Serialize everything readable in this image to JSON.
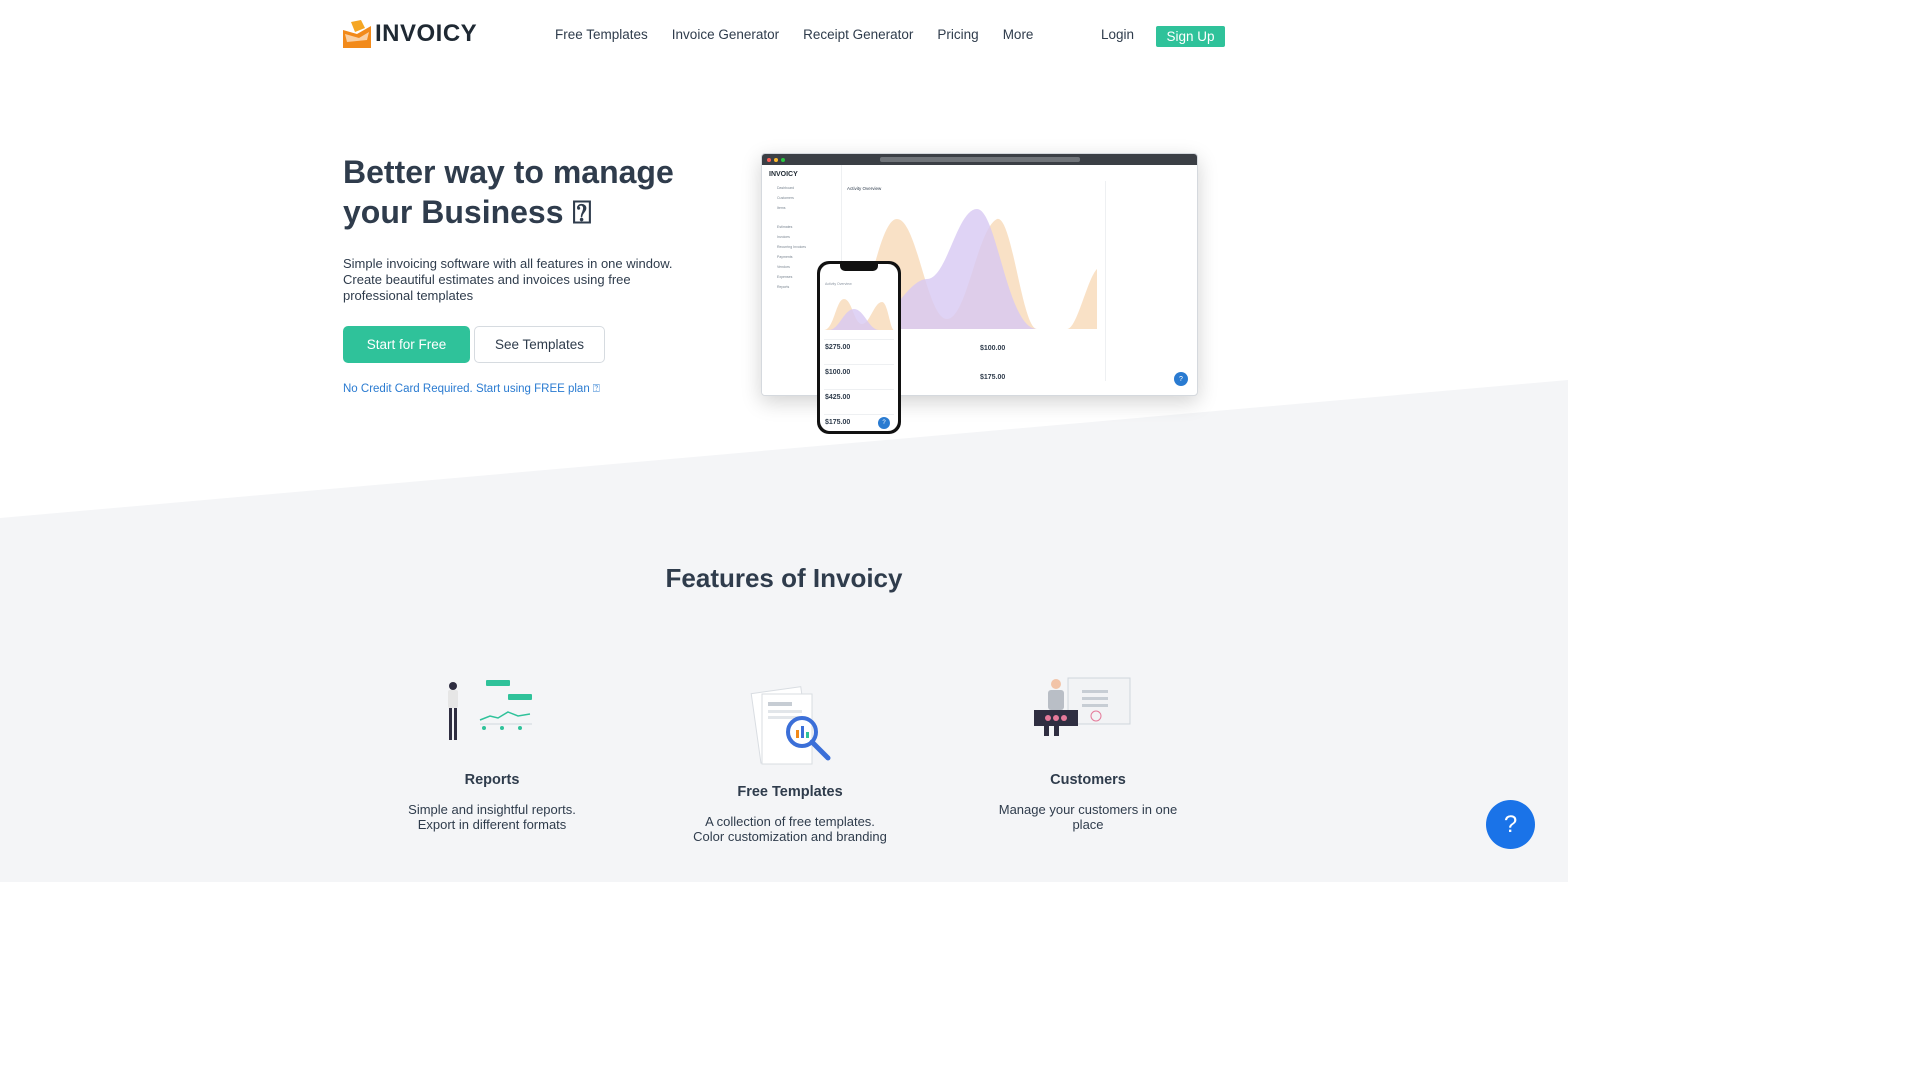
{
  "brand": {
    "name": "INVOICY"
  },
  "nav": {
    "items": [
      "Free Templates",
      "Invoice Generator",
      "Receipt Generator",
      "Pricing",
      "More"
    ],
    "login": "Login",
    "signup": "Sign Up"
  },
  "hero": {
    "title": "Better way to manage your Business ⍰",
    "description": "Simple invoicing software with all features in one window. Create beautiful estimates and invoices using free professional templates",
    "primary_cta": "Start for Free",
    "secondary_cta": "See Templates",
    "note": "No Credit Card Required. Start using FREE plan ⍰"
  },
  "mockup": {
    "logo": "INVOICY",
    "main_title": "Activity Overview",
    "sidebar_items": [
      "Dashboard",
      "Customers",
      "Items",
      "Estimates",
      "Invoices",
      "Recurring Invoices",
      "Payments",
      "Vendors",
      "Expenses",
      "Reports"
    ],
    "desktop_values": [
      "$100.00",
      "$175.00"
    ],
    "phone_title": "Activity Overview",
    "phone_values": [
      "$275.00",
      "$100.00",
      "$425.00",
      "$175.00"
    ]
  },
  "features": {
    "title": "Features of Invoicy",
    "items": [
      {
        "title": "Reports",
        "desc": "Simple and insightful reports. Export in different formats"
      },
      {
        "title": "Free Templates",
        "desc": "A collection of free templates. Color customization and branding"
      },
      {
        "title": "Customers",
        "desc": "Manage your customers in one place"
      }
    ]
  },
  "help": {
    "label": "?"
  },
  "colors": {
    "accent": "#2fc29a",
    "link": "#2a7bd1",
    "text": "#2f3c4c",
    "help": "#1a73e8"
  }
}
